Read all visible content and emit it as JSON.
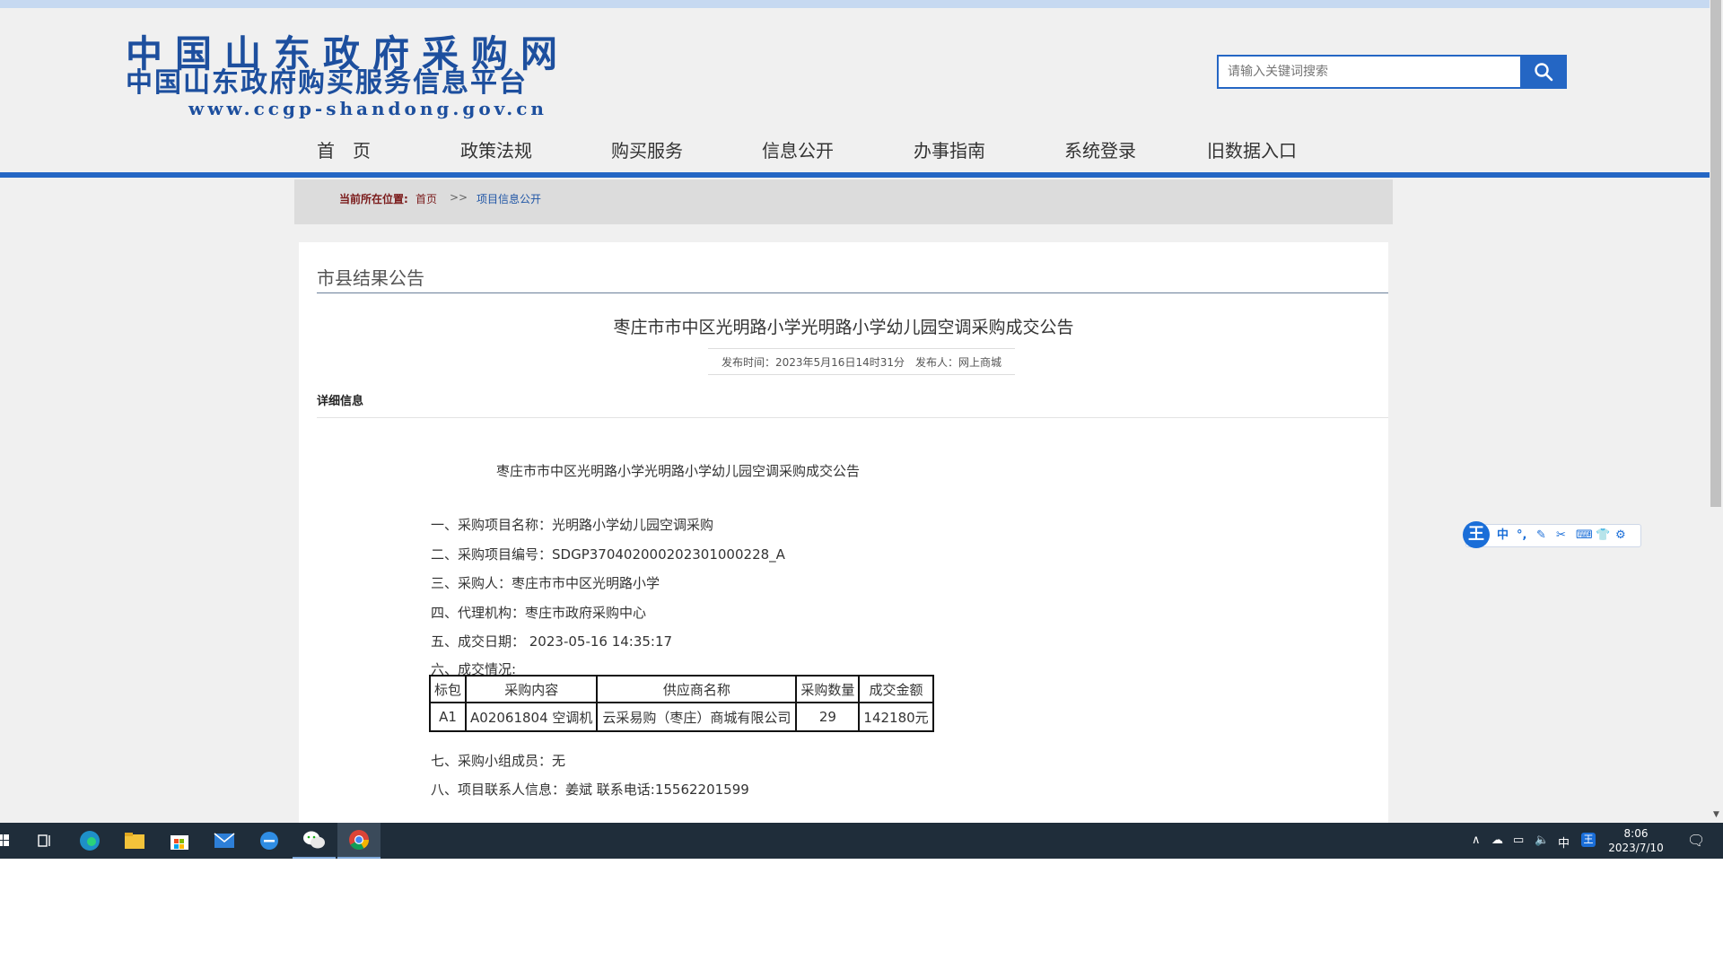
{
  "site": {
    "logo_line1": "中国山东政府采购网",
    "logo_line2": "中国山东政府购买服务信息平台",
    "logo_line3": "www.ccgp-shandong.gov.cn",
    "search_placeholder": "请输入关键词搜索"
  },
  "nav": [
    "首　页",
    "政策法规",
    "购买服务",
    "信息公开",
    "办事指南",
    "系统登录",
    "旧数据入口"
  ],
  "breadcrumb": {
    "label": "当前所在位置:",
    "home": "首页",
    "separator": ">>",
    "current": "项目信息公开"
  },
  "section_title": "市县结果公告",
  "article": {
    "title": "枣庄市市中区光明路小学光明路小学幼儿园空调采购成交公告",
    "meta": "发布时间：2023年5月16日14时31分　发布人：网上商城",
    "detail_label": "详细信息",
    "inner_title": "枣庄市市中区光明路小学光明路小学幼儿园空调采购成交公告",
    "lines": [
      "一、采购项目名称：光明路小学幼儿园空调采购",
      "二、采购项目编号：SDGP370402000202301000228_A",
      "三、采购人：枣庄市市中区光明路小学",
      "四、代理机构：枣庄市政府采购中心",
      "五、成交日期： 2023-05-16 14:35:17",
      "六、成交情况:"
    ],
    "table": {
      "headers": [
        "标包",
        "采购内容",
        "供应商名称",
        "采购数量",
        "成交金额"
      ],
      "row": [
        "A1",
        "A02061804 空调机",
        "云采易购（枣庄）商城有限公司",
        "29",
        "142180元"
      ]
    },
    "after_lines": [
      "七、采购小组成员：无",
      "八、项目联系人信息：姜斌 联系电话:15562201599"
    ]
  },
  "ime": {
    "logo": "王",
    "mode": "中"
  },
  "taskbar": {
    "tray_lang": "中",
    "time": "8:06",
    "date": "2023/7/10"
  },
  "colors": {
    "brand_blue": "#2466c4",
    "logo_blue": "#1d4f9e",
    "taskbar": "#1f2d3a"
  }
}
